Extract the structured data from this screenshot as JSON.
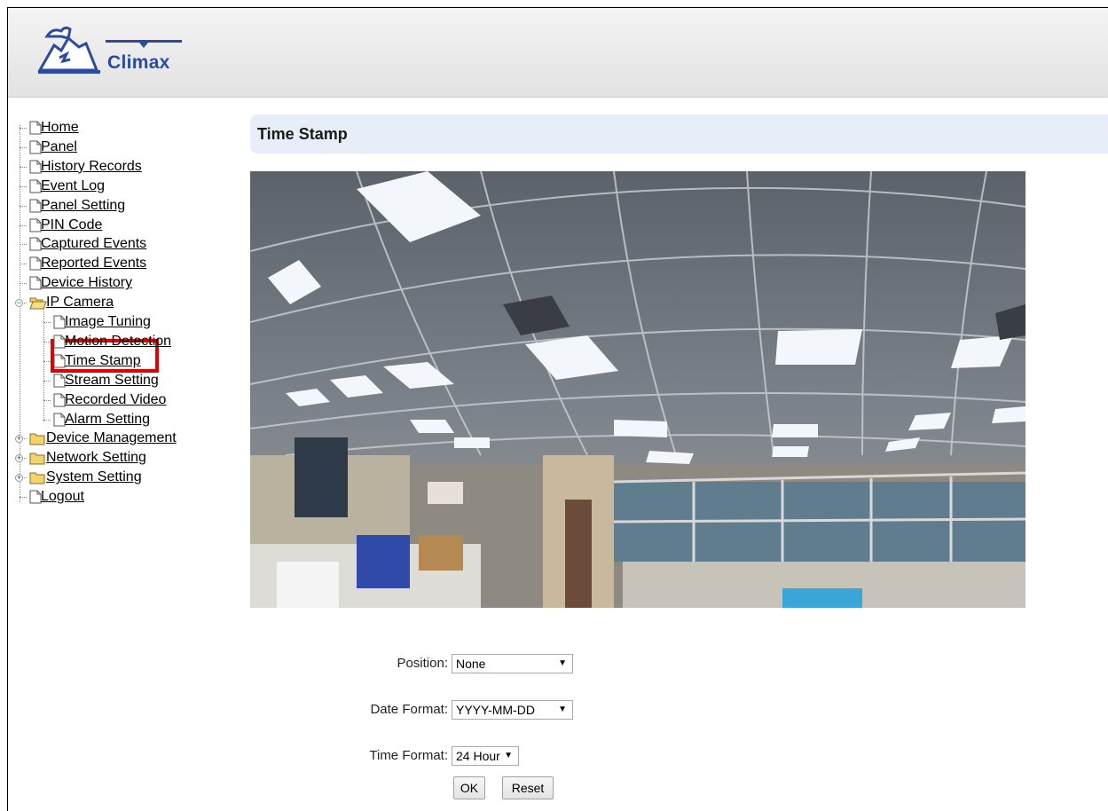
{
  "brand": {
    "name": "Climax"
  },
  "page": {
    "title": "Time Stamp"
  },
  "sidebar": {
    "items": [
      {
        "label": "Home"
      },
      {
        "label": "Panel"
      },
      {
        "label": "History Records"
      },
      {
        "label": "Event Log"
      },
      {
        "label": "Panel Setting"
      },
      {
        "label": "PIN Code"
      },
      {
        "label": "Captured Events"
      },
      {
        "label": "Reported Events"
      },
      {
        "label": "Device History"
      },
      {
        "label": "IP Camera"
      },
      {
        "label": "Image Tuning"
      },
      {
        "label": "Motion Detection"
      },
      {
        "label": "Time Stamp"
      },
      {
        "label": "Stream Setting"
      },
      {
        "label": "Recorded Video"
      },
      {
        "label": "Alarm Setting"
      },
      {
        "label": "Device Management"
      },
      {
        "label": "Network Setting"
      },
      {
        "label": "System Setting"
      },
      {
        "label": "Logout"
      }
    ]
  },
  "form": {
    "position": {
      "label": "Position:",
      "value": "None"
    },
    "date_format": {
      "label": "Date Format:",
      "value": "YYYY-MM-DD"
    },
    "time_format": {
      "label": "Time Format:",
      "value": "24 Hour"
    },
    "ok_label": "OK",
    "reset_label": "Reset"
  },
  "icons": {
    "page": "page-icon",
    "folder_open": "folder-open-icon",
    "folder_closed": "folder-icon",
    "expand": "plus-icon",
    "collapse": "minus-icon"
  },
  "colors": {
    "highlight": "#e20000",
    "title_bar": "#e7eef7",
    "brand": "#2c4aa0"
  }
}
